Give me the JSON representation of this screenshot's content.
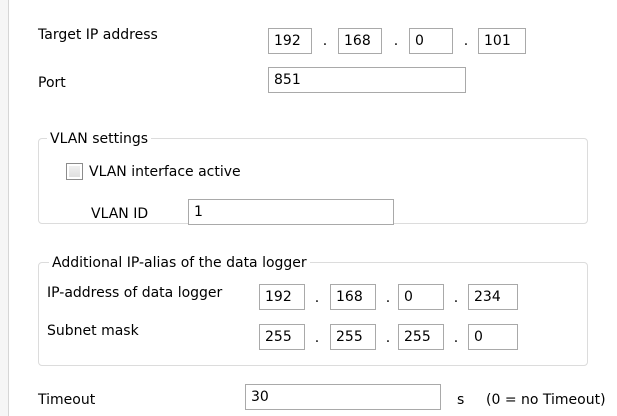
{
  "target_ip": {
    "label": "Target IP address",
    "octets": [
      "192",
      "168",
      "0",
      "101"
    ]
  },
  "port": {
    "label": "Port",
    "value": "851"
  },
  "vlan": {
    "group_label": "VLAN settings",
    "checkbox_label": "VLAN interface active",
    "checked": false,
    "id_label": "VLAN ID",
    "id_value": "1"
  },
  "alias": {
    "group_label": "Additional IP-alias of the data logger",
    "ip_label": "IP-address of data logger",
    "ip_octets": [
      "192",
      "168",
      "0",
      "234"
    ],
    "subnet_label": "Subnet mask",
    "subnet_octets": [
      "255",
      "255",
      "255",
      "0"
    ]
  },
  "timeout": {
    "label": "Timeout",
    "value": "30",
    "unit": "s",
    "hint": "(0 = no Timeout)"
  },
  "separator": "."
}
